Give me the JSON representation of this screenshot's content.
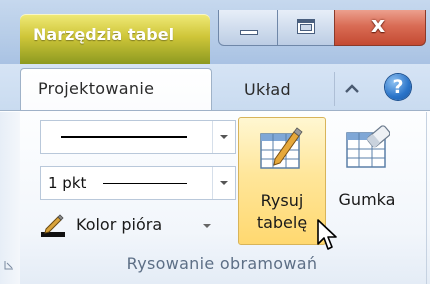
{
  "titlebar": {
    "contextual_tab_label": "Narzędzia tabel",
    "close_symbol": "x",
    "colors": {
      "contextual_tab": "#cfc639",
      "close_button": "#d96c55",
      "frame": "#b7cde8"
    }
  },
  "tabs": {
    "active_label": "Projektowanie",
    "inactive_label": "Układ",
    "help_symbol": "?",
    "minimize_icon": "chevron-up-icon"
  },
  "ribbon": {
    "line_style_icon": "solid-line-icon",
    "line_width_value": "1 pkt",
    "pen_color_label": "Kolor pióra",
    "pen_color_icon": "pen-icon",
    "draw_table": {
      "line1": "Rysuj",
      "line2": "tabelę",
      "icon": "draw-table-icon",
      "highlight": "#ffe69a"
    },
    "eraser": {
      "label": "Gumka",
      "icon": "eraser-icon"
    },
    "group_label": "Rysowanie obramowań"
  }
}
